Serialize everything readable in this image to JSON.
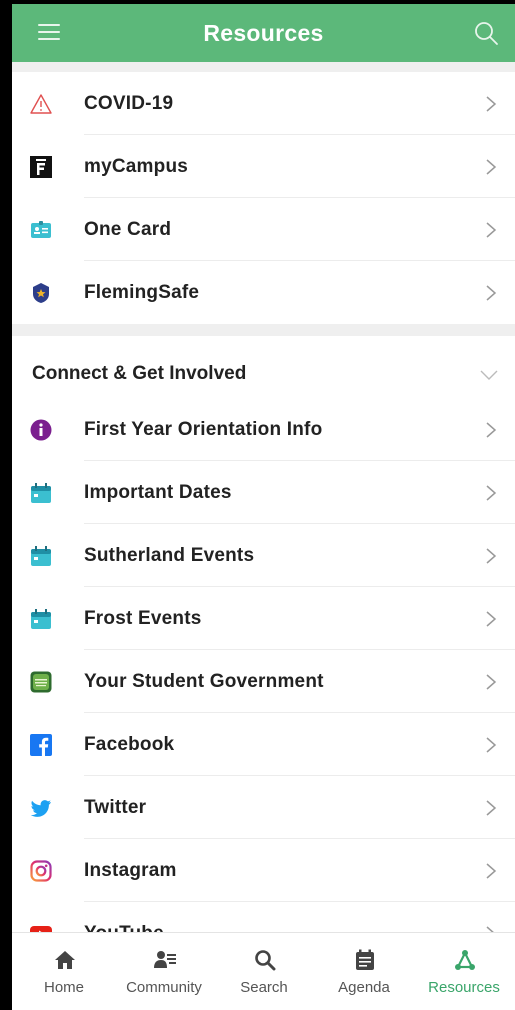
{
  "header": {
    "title": "Resources"
  },
  "top_items": [
    {
      "label": "COVID-19",
      "icon": "warning-icon"
    },
    {
      "label": "myCampus",
      "icon": "fleming-logo-icon"
    },
    {
      "label": "One Card",
      "icon": "id-card-icon"
    },
    {
      "label": "FlemingSafe",
      "icon": "police-badge-icon"
    }
  ],
  "section": {
    "title": "Connect & Get Involved",
    "items": [
      {
        "label": "First Year Orientation Info",
        "icon": "info-icon"
      },
      {
        "label": "Important Dates",
        "icon": "calendar-icon"
      },
      {
        "label": "Sutherland Events",
        "icon": "calendar-icon"
      },
      {
        "label": "Frost Events",
        "icon": "calendar-icon"
      },
      {
        "label": "Your Student Government",
        "icon": "student-council-icon"
      },
      {
        "label": "Facebook",
        "icon": "facebook-icon"
      },
      {
        "label": "Twitter",
        "icon": "twitter-icon"
      },
      {
        "label": "Instagram",
        "icon": "instagram-icon"
      },
      {
        "label": "YouTube",
        "icon": "youtube-icon"
      }
    ]
  },
  "tabs": [
    {
      "label": "Home",
      "icon": "home-icon"
    },
    {
      "label": "Community",
      "icon": "community-icon"
    },
    {
      "label": "Search",
      "icon": "search-icon"
    },
    {
      "label": "Agenda",
      "icon": "agenda-icon"
    },
    {
      "label": "Resources",
      "icon": "resources-icon",
      "active": true
    }
  ],
  "colors": {
    "header": "#5cb87a",
    "active_tab": "#3aa56a",
    "calendar": "#3bbfd0"
  }
}
